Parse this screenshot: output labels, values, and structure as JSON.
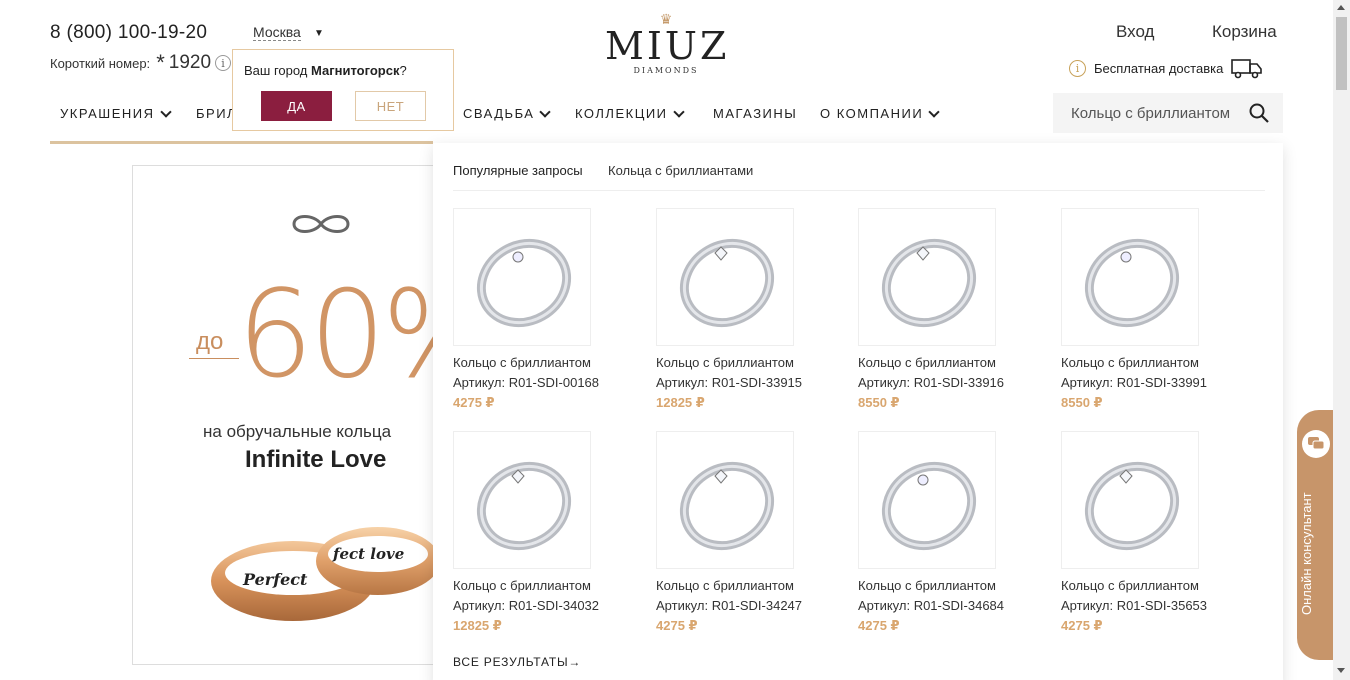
{
  "header": {
    "phone": "8 (800) 100-19-20",
    "short_label": "Короткий номер:",
    "short_star": "*",
    "short_number": "1920",
    "city": "Москва",
    "login": "Вход",
    "cart": "Корзина",
    "delivery": "Бесплатная доставка",
    "logo_name": "MIUZ",
    "logo_sub": "DIAMONDS"
  },
  "city_popup": {
    "question_prefix": "Ваш город ",
    "city": "Магнитогорск",
    "question_suffix": "?",
    "yes": "ДА",
    "no": "НЕТ"
  },
  "nav": {
    "items": [
      "УКРАШЕНИЯ",
      "БРИЛ",
      "СВАДЬБА",
      "КОЛЛЕКЦИИ",
      "МАГАЗИНЫ",
      "О КОМПАНИИ"
    ]
  },
  "search": {
    "value": "Кольцо с бриллиантом"
  },
  "banner": {
    "upto": "до",
    "percent": "60%",
    "line1": "на обручальные кольца",
    "line2": "Infinite Love",
    "ring1_text": "Perfect",
    "ring2_text": "fect love"
  },
  "dropdown": {
    "popular_label": "Популярные запросы",
    "popular_link": "Кольца с бриллиантами",
    "all_results": "ВСЕ РЕЗУЛЬТАТЫ→",
    "products": [
      {
        "name": "Кольцо с бриллиантом",
        "article": "Артикул: R01-SDI-00168",
        "price": "4275 ₽"
      },
      {
        "name": "Кольцо с бриллиантом",
        "article": "Артикул: R01-SDI-33915",
        "price": "12825 ₽"
      },
      {
        "name": "Кольцо с бриллиантом",
        "article": "Артикул: R01-SDI-33916",
        "price": "8550 ₽"
      },
      {
        "name": "Кольцо с бриллиантом",
        "article": "Артикул: R01-SDI-33991",
        "price": "8550 ₽"
      },
      {
        "name": "Кольцо с бриллиантом",
        "article": "Артикул: R01-SDI-34032",
        "price": "12825 ₽"
      },
      {
        "name": "Кольцо с бриллиантом",
        "article": "Артикул: R01-SDI-34247",
        "price": "4275 ₽"
      },
      {
        "name": "Кольцо с бриллиантом",
        "article": "Артикул: R01-SDI-34684",
        "price": "4275 ₽"
      },
      {
        "name": "Кольцо с бриллиантом",
        "article": "Артикул: R01-SDI-35653",
        "price": "4275 ₽"
      }
    ]
  },
  "consultant": {
    "label": "Онлайн консультант"
  },
  "colors": {
    "accent_burgundy": "#8b1e3f",
    "gold": "#c7956a",
    "price": "#d9a66f"
  }
}
